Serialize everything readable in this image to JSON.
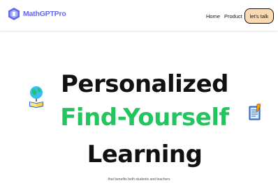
{
  "brand": {
    "name": "MathGPTPro",
    "color": "#6366f1"
  },
  "nav": {
    "links": [
      "Home",
      "Product"
    ],
    "cta_label": "let's talk",
    "cta_color": "#fbd9b3"
  },
  "hero": {
    "line1": "Personalized",
    "line2": "Find-Yourself",
    "line3": "Learning",
    "tagline": "that benefits both students and teachers",
    "accent_color": "#22c55e"
  },
  "icons": {
    "logo": "mathgptpro-logo-icon",
    "left_decoration": "globe-book-icon",
    "right_decoration": "notebook-pencil-icon"
  }
}
